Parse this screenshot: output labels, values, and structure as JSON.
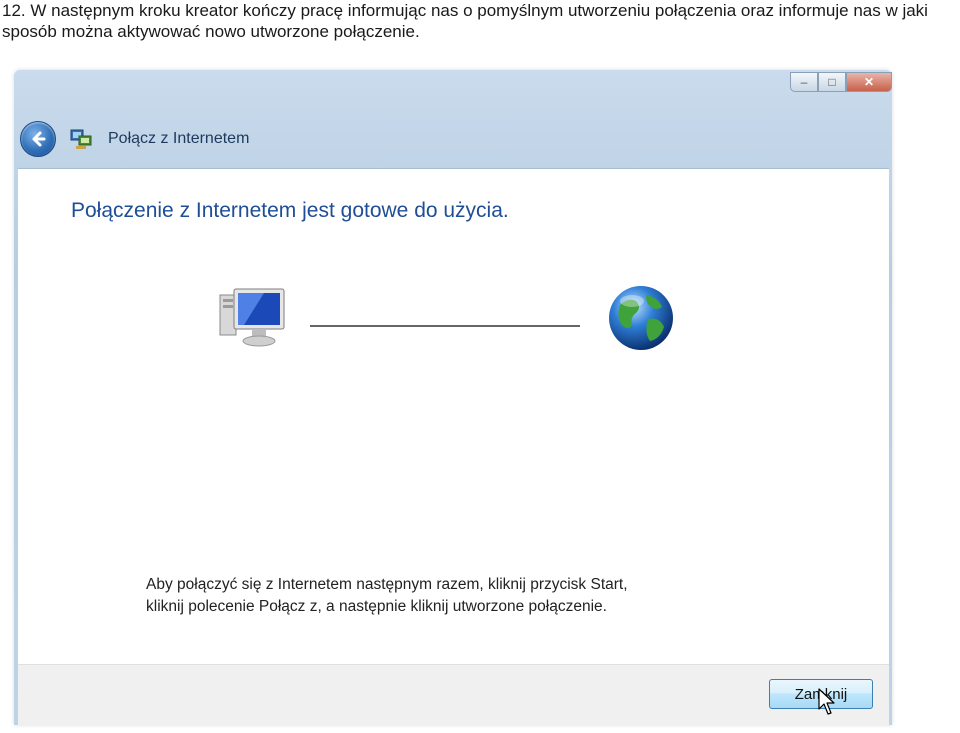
{
  "document": {
    "caption": "12. W następnym kroku kreator kończy pracę informując nas o pomyślnym utworzeniu połączenia oraz informuje nas w jaki sposób można aktywować nowo utworzone połączenie."
  },
  "window": {
    "title": "Połącz z Internetem",
    "controls": {
      "minimize": "–",
      "maximize": "□",
      "close": "✕"
    }
  },
  "content": {
    "heading": "Połączenie z Internetem jest gotowe do użycia.",
    "icons": {
      "computer": "computer-icon",
      "globe": "globe-icon"
    },
    "instructions_line1": "Aby połączyć się z Internetem następnym razem, kliknij przycisk Start,",
    "instructions_line2": "kliknij polecenie Połącz z, a następnie kliknij utworzone połączenie."
  },
  "footer": {
    "close_label": "Zamknij"
  },
  "colors": {
    "heading": "#1f4e96",
    "title": "#1e395b",
    "accent": "#3c7fb1"
  }
}
